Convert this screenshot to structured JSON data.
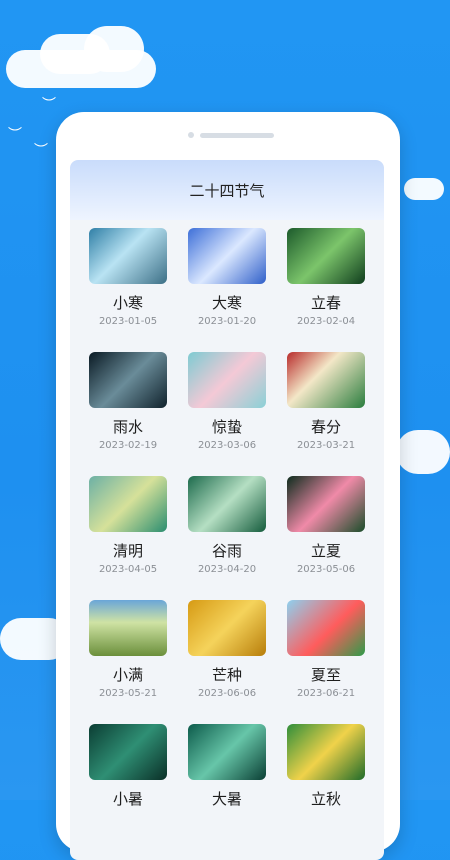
{
  "header": {
    "title": "二十四节气"
  },
  "terms": [
    {
      "name": "小寒",
      "date": "2023-01-05",
      "icon": "snow-bubble-image"
    },
    {
      "name": "大寒",
      "date": "2023-01-20",
      "icon": "frost-branch-image"
    },
    {
      "name": "立春",
      "date": "2023-02-04",
      "icon": "butterfly-sprout-image"
    },
    {
      "name": "雨水",
      "date": "2023-02-19",
      "icon": "water-drop-image"
    },
    {
      "name": "惊蛰",
      "date": "2023-03-06",
      "icon": "hummingbird-image"
    },
    {
      "name": "春分",
      "date": "2023-03-21",
      "icon": "blossom-wall-image"
    },
    {
      "name": "清明",
      "date": "2023-04-05",
      "icon": "leaf-image"
    },
    {
      "name": "谷雨",
      "date": "2023-04-20",
      "icon": "grass-image"
    },
    {
      "name": "立夏",
      "date": "2023-05-06",
      "icon": "lotus-image"
    },
    {
      "name": "小满",
      "date": "2023-05-21",
      "icon": "wheat-field-image"
    },
    {
      "name": "芒种",
      "date": "2023-06-06",
      "icon": "grain-image"
    },
    {
      "name": "夏至",
      "date": "2023-06-21",
      "icon": "watermelon-image"
    },
    {
      "name": "小暑",
      "date": "",
      "icon": "dragonfly-image"
    },
    {
      "name": "大暑",
      "date": "",
      "icon": "frog-leaf-image"
    },
    {
      "name": "立秋",
      "date": "",
      "icon": "ginkgo-image"
    }
  ],
  "colors": {
    "background": "#2196f3",
    "card": "#ffffff",
    "date_text": "#8b8f95"
  }
}
